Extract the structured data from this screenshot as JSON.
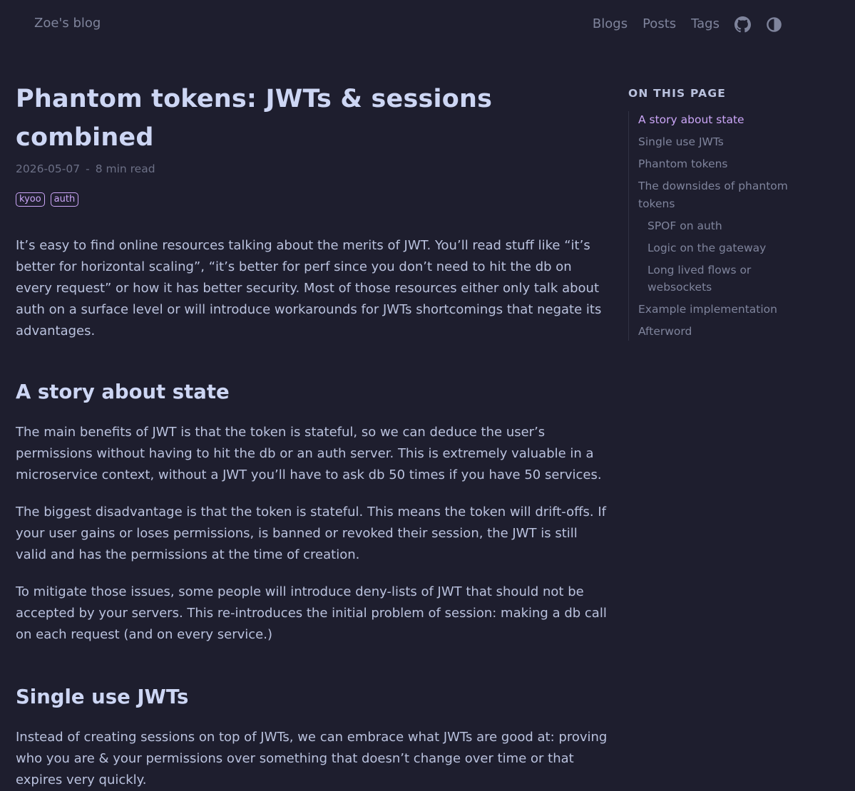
{
  "header": {
    "site_title": "Zoe's blog",
    "nav": [
      "Blogs",
      "Posts",
      "Tags"
    ]
  },
  "article": {
    "title": "Phantom tokens: JWTs & sessions combined",
    "date": "2026-05-07",
    "separator": "-",
    "read_time": "8 min read",
    "tags": [
      "kyoo",
      "auth"
    ],
    "intro": "It’s easy to find online resources talking about the merits of JWT. You’ll read stuff like “it’s better for horizontal scaling”, “it’s better for perf since you don’t need to hit the db on every request” or how it has better security. Most of those resources either only talk about auth on a surface level or will introduce workarounds for JWTs shortcomings that negate its advantages.",
    "section1": {
      "heading": "A story about state",
      "paragraphs": [
        "The main benefits of JWT is that the token is stateful, so we can deduce the user’s permissions without having to hit the db or an auth server. This is extremely valuable in a microservice context, without a JWT you’ll have to ask db 50 times if you have 50 services.",
        "The biggest disadvantage is that the token is stateful. This means the token will drift-offs. If your user gains or loses permissions, is banned or revoked their session, the JWT is still valid and has the permissions at the time of creation.",
        "To mitigate those issues, some people will introduce deny-lists of JWT that should not be accepted by your servers. This re-introduces the initial problem of session: making a db call on each request (and on every service.)"
      ]
    },
    "section2": {
      "heading": "Single use JWTs",
      "paragraphs": [
        "Instead of creating sessions on top of JWTs, we can embrace what JWTs are good at: proving who you are & your permissions over something that doesn’t change over time or that expires very quickly."
      ]
    }
  },
  "toc": {
    "title": "ON THIS PAGE",
    "items": [
      {
        "label": "A story about state",
        "level": 1,
        "active": true
      },
      {
        "label": "Single use JWTs",
        "level": 1,
        "active": false
      },
      {
        "label": "Phantom tokens",
        "level": 1,
        "active": false
      },
      {
        "label": "The downsides of phantom tokens",
        "level": 1,
        "active": false
      },
      {
        "label": "SPOF on auth",
        "level": 2,
        "active": false
      },
      {
        "label": "Logic on the gateway",
        "level": 2,
        "active": false
      },
      {
        "label": "Long lived flows or websockets",
        "level": 2,
        "active": false
      },
      {
        "label": "Example implementation",
        "level": 1,
        "active": false
      },
      {
        "label": "Afterword",
        "level": 1,
        "active": false
      }
    ]
  },
  "icons": {
    "github": "github-icon",
    "theme_toggle": "theme-toggle-icon"
  },
  "colors": {
    "background": "#1e1e2e",
    "heading": "#cdd6f4",
    "text": "#bac2de",
    "muted": "#7f849c",
    "accent": "#cba6f7"
  }
}
